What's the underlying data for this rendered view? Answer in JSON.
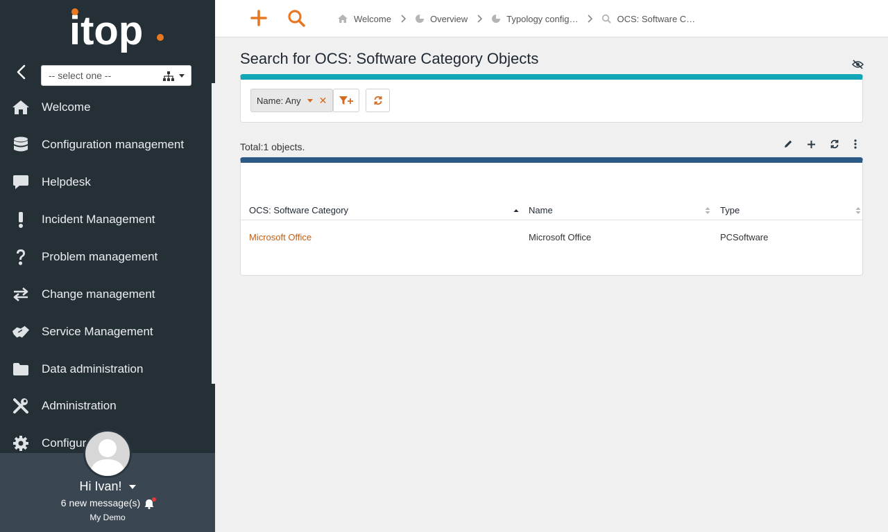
{
  "app": {
    "logo_text": "itop"
  },
  "sidebar": {
    "org_select": {
      "value": "-- select one --"
    },
    "items": [
      {
        "label": "Welcome",
        "icon": "home-icon"
      },
      {
        "label": "Configuration management",
        "icon": "database-icon"
      },
      {
        "label": "Helpdesk",
        "icon": "comment-icon"
      },
      {
        "label": "Incident Management",
        "icon": "exclamation-icon"
      },
      {
        "label": "Problem management",
        "icon": "question-icon"
      },
      {
        "label": "Change management",
        "icon": "exchange-icon"
      },
      {
        "label": "Service Management",
        "icon": "handshake-icon"
      },
      {
        "label": "Data administration",
        "icon": "folder-icon"
      },
      {
        "label": "Administration",
        "icon": "tools-icon"
      },
      {
        "label": "Configur",
        "icon": "gear-icon"
      }
    ]
  },
  "user": {
    "greeting": "Hi Ivan!",
    "messages": "6 new message(s)",
    "organization": "My Demo"
  },
  "breadcrumb": [
    {
      "label": "Welcome",
      "icon": "home-icon"
    },
    {
      "label": "Overview",
      "icon": "pie-chart-icon"
    },
    {
      "label": "Typology config…",
      "icon": "pie-chart-icon"
    },
    {
      "label": "OCS: Software C…",
      "icon": "search-icon"
    }
  ],
  "main": {
    "title": "Search for OCS: Software Category Objects",
    "criteria_label": "Name: Any",
    "total": "Total:1 objects.",
    "table": {
      "columns": [
        "OCS: Software Category",
        "Name",
        "Type"
      ],
      "rows": [
        [
          "Microsoft Office",
          "Microsoft Office",
          "PCSoftware"
        ]
      ]
    }
  },
  "colors": {
    "accent": "#e87722",
    "sidebar_bg": "#242f36",
    "search_panel_top": "#12a6b8",
    "results_panel_top": "#2b5b84",
    "link": "#c25e19"
  }
}
